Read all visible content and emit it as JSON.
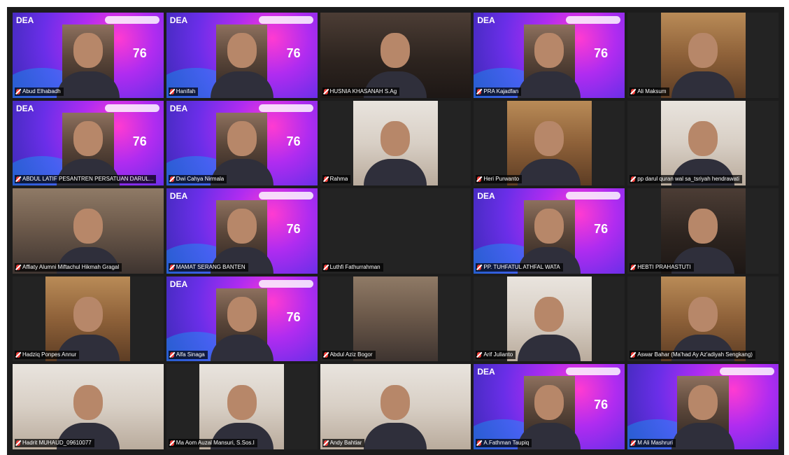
{
  "meeting": {
    "participants": [
      {
        "name": "Abud Elhabadh",
        "mic": "muted-icon"
      },
      {
        "name": "Hanifah",
        "mic": "muted-icon"
      },
      {
        "name": "HUSNIA KHASANAH S.Ag",
        "mic": "muted-icon"
      },
      {
        "name": "PRA Kajadfan",
        "mic": "muted-icon"
      },
      {
        "name": "Ali Maksum",
        "mic": "muted-icon"
      },
      {
        "name": "ABDUL LATIF PESANTREN PERSATUAN DARUL...",
        "mic": "muted-icon"
      },
      {
        "name": "Dwi Cahya Nirmala",
        "mic": "muted-icon"
      },
      {
        "name": "Rahma",
        "mic": "muted-icon"
      },
      {
        "name": "Heri Purwanto",
        "mic": "muted-icon"
      },
      {
        "name": "pp darul quran wal sa_tsriyah hendrawati",
        "mic": "muted-icon"
      },
      {
        "name": "Affiaty Alumni Miftachul Hikmah Gragal",
        "mic": "muted-icon"
      },
      {
        "name": "MAMAT SERANG BANTEN",
        "mic": "muted-icon"
      },
      {
        "name": "Luthfi Fathurrahman",
        "mic": "muted-icon"
      },
      {
        "name": "PP. TUHFATUL ATHFAL WATA",
        "mic": "muted-icon"
      },
      {
        "name": "HEBTI PRAHASTUTI",
        "mic": "muted-icon"
      },
      {
        "name": "Hadziq Ponpes Annur",
        "mic": "muted-icon"
      },
      {
        "name": "Alfa Sinaga",
        "mic": "muted-icon"
      },
      {
        "name": "Abdul Aziz Bogor",
        "mic": "muted-icon"
      },
      {
        "name": "Arif Julianto",
        "mic": "muted-icon"
      },
      {
        "name": "Aswar Bahar (Ma'had Ay Az'adiyah Sengkang)",
        "mic": "muted-icon"
      },
      {
        "name": "Hadrit MUHAUD_09610077",
        "mic": "muted-icon"
      },
      {
        "name": "Ma Aom Auzal Mansuri, S.Sos.I",
        "mic": "muted-icon"
      },
      {
        "name": "Andy Bahtiar",
        "mic": "muted-icon"
      },
      {
        "name": "A.Fathman Taupiq",
        "mic": "muted-icon"
      },
      {
        "name": "M Ali Mashruri",
        "mic": "muted-icon"
      }
    ],
    "overlay": {
      "brand": "DEA",
      "badge": "76"
    }
  }
}
